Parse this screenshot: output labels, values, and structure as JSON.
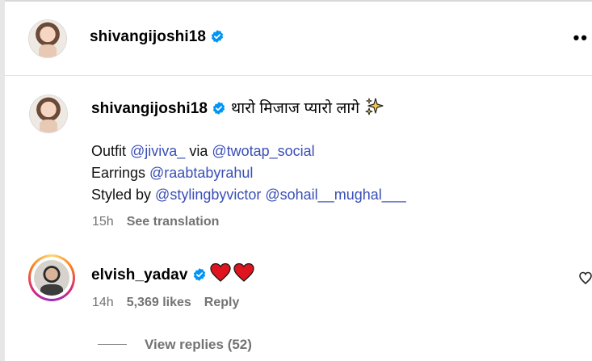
{
  "post": {
    "header": {
      "username": "shivangijoshi18",
      "more_label": "••"
    },
    "caption": {
      "username": "shivangijoshi18",
      "text": "थारो मिजाज प्यारो लागे",
      "outfit_label": "Outfit ",
      "outfit_handle": "@jiviva_",
      "via_label": " via ",
      "via_handle": "@twotap_social",
      "earrings_label": "Earrings ",
      "earrings_handle": "@raabtabyrahul",
      "styled_label": "Styled by ",
      "styled_handle_1": "@stylingbyvictor",
      "styled_handle_2": "@sohail__mughal___",
      "time": "15h",
      "see_translation": "See translation"
    },
    "comment": {
      "username": "elvish_yadav",
      "time": "14h",
      "likes": "5,369 likes",
      "reply": "Reply",
      "view_replies": "View replies (52)"
    }
  },
  "colors": {
    "link": "#3a4fb7",
    "verified": "#0095f6",
    "heart": "#e0141e",
    "meta": "#737373"
  },
  "icons": [
    "verified-badge-icon",
    "more-options-icon",
    "sparkles-icon",
    "red-heart-icon",
    "like-heart-icon"
  ]
}
